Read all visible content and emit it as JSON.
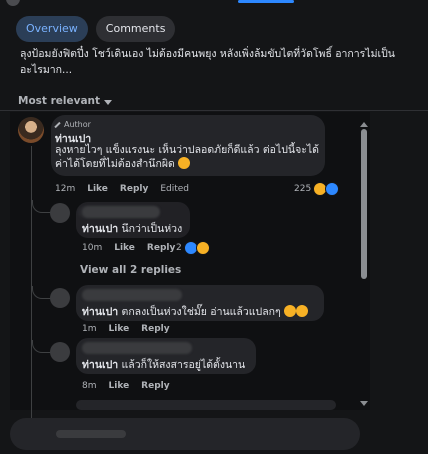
{
  "tabs": [
    {
      "label": "Overview",
      "active": true
    },
    {
      "label": "Comments",
      "active": false
    }
  ],
  "post": {
    "text": "ลุงป้อมยังฟิตปึ๋ง โชว์เดินเอง ไม่ต้องมีคนพยุง หลังเพิ่งล้มขับไตที่วัดโพธิ์ อาการไม่เป็นอะไรมาก..."
  },
  "sort_label": "Most relevant",
  "comments": [
    {
      "badge": "Author",
      "name": "ท่านเปา",
      "text": "ลุงหายไวๆ แข็งแรงนะ เห็นว่าปลอดภัยก็ดีแล้ว ต่อไปนี้จะได้ค่าได้โดยที่ไม่ต้องสำนึกผิด",
      "time": "12m",
      "like": "Like",
      "reply": "Reply",
      "edited": "Edited",
      "reactions": "225",
      "replies": [
        {
          "name": "ท่านเปา",
          "text": "นึกว่าเป็นห่วง",
          "time": "10m",
          "like": "Like",
          "reply": "Reply",
          "reactions": "2"
        }
      ],
      "view_all": "View all 2 replies"
    },
    {
      "name": "ท่านเปา",
      "text": "ตกลงเป็นห่วงใช่มั๊ย อ่านแล้วแปลกๆ",
      "time": "1m",
      "like": "Like",
      "reply": "Reply"
    },
    {
      "name": "ท่านเปา",
      "text": "แล้วก็ให้สงสารอยู่ได้ตั้งนาน",
      "time": "8m",
      "like": "Like",
      "reply": "Reply"
    }
  ],
  "composer": {
    "placeholder": ""
  },
  "colors": {
    "accent": "#2d88ff",
    "bubble": "#242529",
    "background": "#141517"
  }
}
